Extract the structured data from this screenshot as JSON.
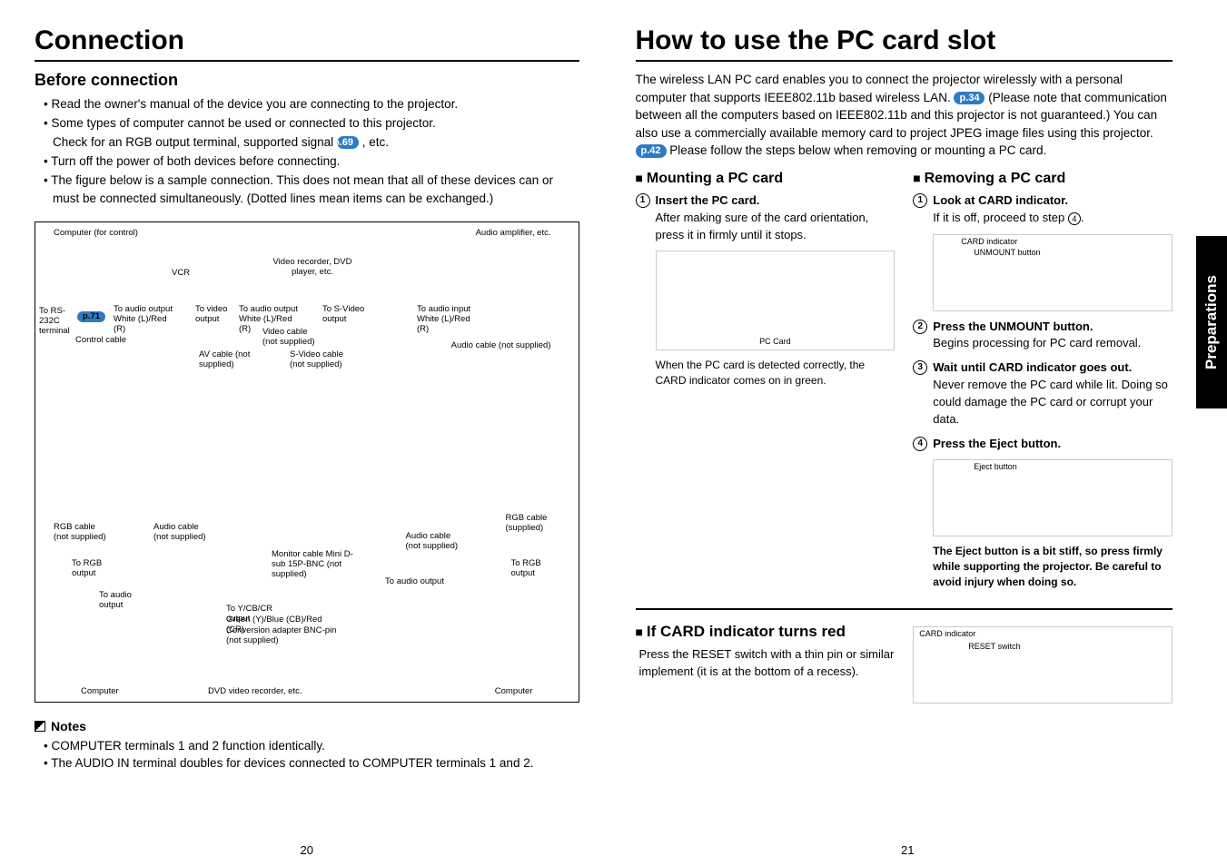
{
  "page_left_number": "20",
  "page_right_number": "21",
  "side_tab": "Preparations",
  "left": {
    "title": "Connection",
    "subtitle": "Before connection",
    "bullets": [
      "Read the owner's manual of the device you are connecting to the projector.",
      "Some types of computer cannot be used or connected to this projector.",
      "Check for an RGB output terminal, supported signal",
      ", etc.",
      "Turn off the power of both devices before connecting.",
      "The figure below is a sample connection. This does not mean that all of these devices can or must be connected simultaneously. (Dotted lines mean items can be exchanged.)"
    ],
    "pref_b3": "p.69",
    "diagram": {
      "computer_for_control": "Computer (for control)",
      "audio_amp": "Audio amplifier, etc.",
      "vcr": "VCR",
      "video_recorder": "Video recorder, DVD player, etc.",
      "to_rs232c": "To RS-232C terminal",
      "pref_rs": "p.71",
      "control_cable": "Control cable",
      "to_audio_output_wr": "To audio output White (L)/Red (R)",
      "to_video_output": "To video output",
      "to_svideo_output": "To S-Video output",
      "to_audio_input_wr": "To audio input White (L)/Red (R)",
      "av_cable": "AV cable (not supplied)",
      "video_cable": "Video cable (not supplied)",
      "svideo_cable": "S-Video cable (not supplied)",
      "audio_cable_ns": "Audio cable (not supplied)",
      "rgb_cable_ns": "RGB cable (not supplied)",
      "rgb_cable_s": "RGB cable (supplied)",
      "to_rgb_output": "To RGB output",
      "to_audio_output": "To audio output",
      "monitor_cable": "Monitor cable Mini D-sub 15P-BNC (not supplied)",
      "to_ycbcr": "To Y/CB/CR output",
      "green_blue_red": "Green (Y)/Blue (CB)/Red (CR)",
      "conversion_adapter": "Conversion adapter BNC-pin (not supplied)",
      "computer": "Computer",
      "dvd_recorder": "DVD video recorder, etc."
    },
    "notes_heading": "Notes",
    "notes": [
      "COMPUTER terminals 1 and 2 function identically.",
      "The AUDIO IN terminal doubles for devices connected to COMPUTER terminals 1 and 2."
    ]
  },
  "right": {
    "title": "How to use the PC card slot",
    "intro_a": "The wireless LAN PC card enables you to connect the projector wirelessly with a personal computer that supports IEEE802.11b based wireless LAN.",
    "pref_a": "p.34",
    "intro_b": "(Please note that communication between all the computers based on IEEE802.11b and this projector is not guaranteed.)  You can also use a commercially available memory card to project JPEG image files using this projector.",
    "pref_b": "p.42",
    "intro_c": "Please follow the steps below when removing or mounting a PC card.",
    "mount": {
      "heading": "Mounting a PC card",
      "step1_title": "Insert the PC card.",
      "step1_body": "After making sure of the card orientation, press it in firmly until it stops.",
      "pc_card_label": "PC Card",
      "detected": "When the PC card is detected correctly, the CARD indicator comes on in green."
    },
    "remove": {
      "heading": "Removing a PC card",
      "step1_title": "Look at CARD indicator.",
      "step1_body_a": "If it is off, proceed to step",
      "step1_body_b": ".",
      "card_indicator": "CARD indicator",
      "unmount_button": "UNMOUNT button",
      "step2_title": "Press the UNMOUNT button.",
      "step2_body": "Begins processing for PC card removal.",
      "step3_title": "Wait until CARD indicator goes out.",
      "step3_body": "Never remove the PC card while lit. Doing so could damage the PC card or corrupt your data.",
      "step4_title": "Press the Eject button.",
      "eject_button": "Eject button",
      "eject_warning": "The Eject button is a bit stiff, so press firmly while supporting the projector. Be careful to avoid injury when doing so."
    },
    "red": {
      "heading": "If CARD indicator turns red",
      "body": "Press the RESET switch with a thin pin or similar implement (it is at the bottom of a recess).",
      "card_indicator": "CARD indicator",
      "reset_switch": "RESET switch"
    }
  }
}
